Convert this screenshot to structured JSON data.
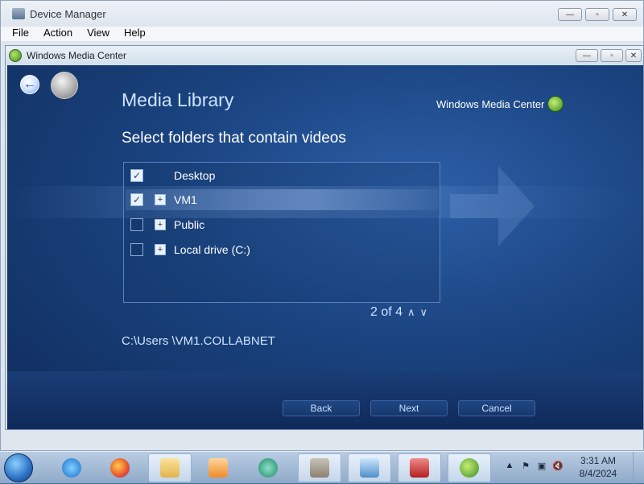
{
  "device_manager": {
    "title": "Device Manager",
    "menu": [
      "File",
      "Action",
      "View",
      "Help"
    ]
  },
  "wmc": {
    "title": "Windows Media Center",
    "heading": "Media Library",
    "brand": "Windows Media Center",
    "subheading": "Select folders that contain videos",
    "folders": [
      {
        "label": "Desktop",
        "checked": true,
        "expandable": false
      },
      {
        "label": "VM1",
        "checked": true,
        "expandable": true
      },
      {
        "label": "Public",
        "checked": false,
        "expandable": true
      },
      {
        "label": "Local drive (C:)",
        "checked": false,
        "expandable": true
      }
    ],
    "pager": {
      "text": "2 of 4",
      "up": "∧",
      "down": "∨"
    },
    "path": "C:\\Users \\VM1.COLLABNET",
    "buttons": {
      "back": "Back",
      "next": "Next",
      "cancel": "Cancel"
    }
  },
  "taskbar": {
    "items": [
      "internet-explorer-icon",
      "firefox-icon",
      "file-explorer-icon",
      "media-player-icon",
      "app-icon",
      "firewall-icon",
      "control-panel-icon",
      "toolbox-icon",
      "media-center-icon"
    ],
    "clock": {
      "time": "3:31 AM",
      "date": "8/4/2024"
    }
  }
}
